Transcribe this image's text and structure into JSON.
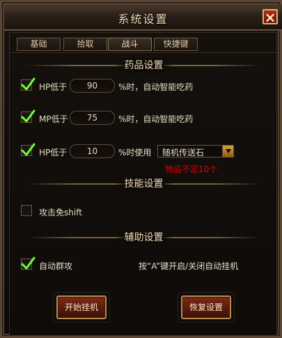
{
  "window": {
    "title": "系统设置"
  },
  "tabs": [
    {
      "label": "基础"
    },
    {
      "label": "拾取"
    },
    {
      "label": "战斗"
    },
    {
      "label": "快捷键"
    }
  ],
  "sections": {
    "medicine": "药品设置",
    "skills": "技能设置",
    "assist": "辅助设置"
  },
  "medicine": {
    "hp": {
      "label": "HP低于",
      "value": "90",
      "suffix": "%时，自动智能吃药",
      "checked": true
    },
    "mp": {
      "label": "MP低于",
      "value": "75",
      "suffix": "%时，自动智能吃药",
      "checked": true
    },
    "hp_item": {
      "label": "HP低于",
      "value": "10",
      "suffix": "%时使用",
      "selected": "随机传送石",
      "checked": true,
      "warning": "物品不足10个"
    }
  },
  "skills": {
    "attack_shift": {
      "label": "攻击免shift",
      "checked": false
    }
  },
  "assist": {
    "auto_group": {
      "label": "自动群攻",
      "checked": true
    },
    "hint": "按“A”键开启/关闭自动挂机"
  },
  "buttons": {
    "start": "开始挂机",
    "reset": "恢复设置"
  },
  "colors": {
    "accent_gold": "#d6b673",
    "warning_red": "#e00000",
    "check_green": "#6cff3a"
  }
}
